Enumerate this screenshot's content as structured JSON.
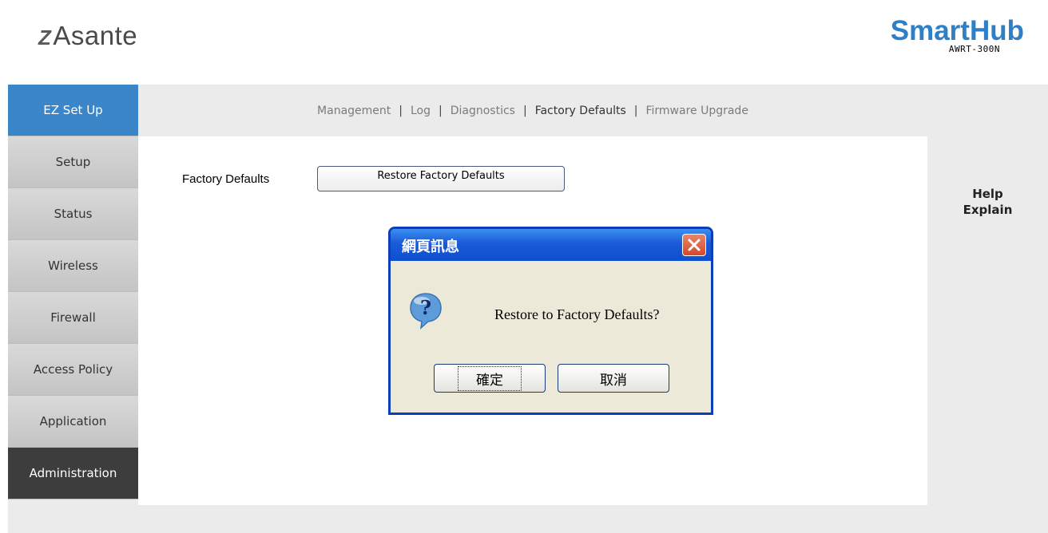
{
  "header": {
    "brand": "Asante",
    "product": "SmartHub",
    "model": "AWRT-300N"
  },
  "sidebar": {
    "items": [
      {
        "label": "EZ Set Up",
        "state": "active"
      },
      {
        "label": "Setup"
      },
      {
        "label": "Status"
      },
      {
        "label": "Wireless"
      },
      {
        "label": "Firewall"
      },
      {
        "label": "Access Policy"
      },
      {
        "label": "Application"
      },
      {
        "label": "Administration",
        "state": "dark"
      }
    ]
  },
  "tabs": {
    "items": [
      "Management",
      "Log",
      "Diagnostics",
      "Factory Defaults",
      "Firmware Upgrade"
    ],
    "selected": "Factory Defaults",
    "separator": "|"
  },
  "content": {
    "factory_label": "Factory Defaults",
    "restore_button": "Restore Factory Defaults"
  },
  "help": {
    "line1": "Help",
    "line2": "Explain"
  },
  "dialog": {
    "title": "網頁訊息",
    "message": "Restore to Factory Defaults?",
    "ok_label": "確定",
    "cancel_label": "取消"
  },
  "colors": {
    "accent_blue": "#3b86c8",
    "brand_blue": "#2f7fc6",
    "dialog_titlebar": "#1a5ad8",
    "close_red": "#d4492b"
  },
  "icons": [
    "asante-logo-icon",
    "close-icon",
    "question-icon"
  ]
}
